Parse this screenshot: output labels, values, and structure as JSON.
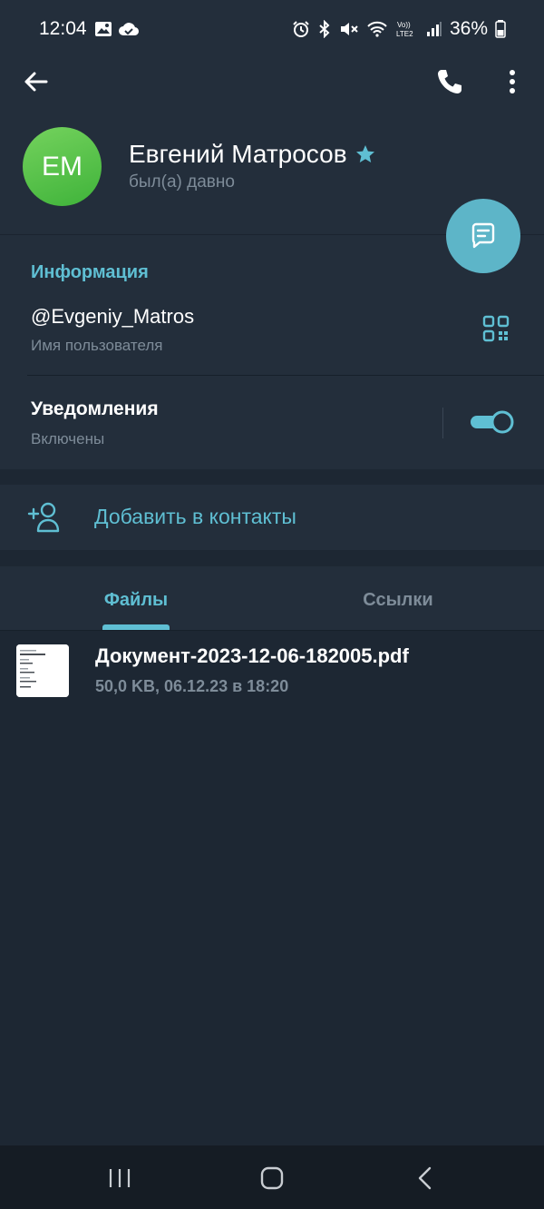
{
  "status_bar": {
    "time": "12:04",
    "battery": "36%",
    "left_icons": [
      "gallery-icon",
      "cloud-check-icon"
    ],
    "right_icons": [
      "alarm-icon",
      "bluetooth-icon",
      "mute-icon",
      "wifi-icon",
      "volte-icon",
      "signal-icon",
      "battery-icon"
    ]
  },
  "app_bar": {
    "icons": [
      "back-arrow-icon",
      "phone-icon",
      "more-vert-icon"
    ]
  },
  "profile": {
    "initials": "EM",
    "name": "Евгений Матросов",
    "status": "был(а) давно",
    "avatar_color": "#4fc045",
    "verified_star_color": "#5fbfd3"
  },
  "fab": {
    "icon": "message-icon",
    "color": "#5db5c8"
  },
  "info": {
    "section_title": "Информация",
    "username": "@Evgeniy_Matros",
    "username_label": "Имя пользователя",
    "qr_icon": "qr-code-icon",
    "notifications_title": "Уведомления",
    "notifications_status": "Включены",
    "notifications_enabled": true
  },
  "actions": {
    "add_contact": "Добавить в контакты",
    "add_contact_icon": "add-person-icon"
  },
  "tabs": {
    "files": "Файлы",
    "links": "Ссылки",
    "active": "files"
  },
  "files": [
    {
      "name": "Документ-2023-12-06-182005.pdf",
      "meta": "50,0 KB, 06.12.23 в 18:20"
    }
  ],
  "nav_bar": {
    "icons": [
      "recent-apps-icon",
      "home-icon",
      "back-icon"
    ]
  },
  "colors": {
    "accent": "#5fbfd3",
    "background": "#1d2733",
    "surface": "#232e3b",
    "secondary_text": "#7e8c99"
  }
}
